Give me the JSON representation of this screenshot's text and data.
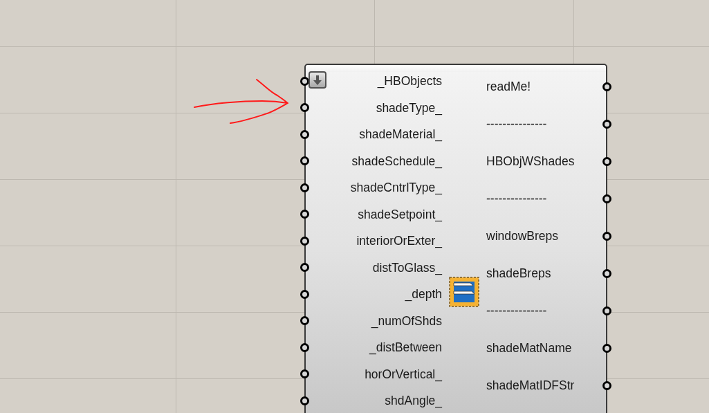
{
  "component": {
    "inputs": [
      {
        "label": "_HBObjects"
      },
      {
        "label": "shadeType_"
      },
      {
        "label": "shadeMaterial_"
      },
      {
        "label": "shadeSchedule_"
      },
      {
        "label": "shadeCntrlType_"
      },
      {
        "label": "shadeSetpoint_"
      },
      {
        "label": "interiorOrExter_"
      },
      {
        "label": "distToGlass_"
      },
      {
        "label": "_depth"
      },
      {
        "label": "_numOfShds"
      },
      {
        "label": "_distBetween"
      },
      {
        "label": "horOrVertical_"
      },
      {
        "label": "shdAngle_"
      }
    ],
    "outputs": [
      {
        "label": "readMe!"
      },
      {
        "label": "---------------"
      },
      {
        "label": "HBObjWShades"
      },
      {
        "label": "---------------"
      },
      {
        "label": "windowBreps"
      },
      {
        "label": "shadeBreps"
      },
      {
        "label": "---------------"
      },
      {
        "label": "shadeMatName"
      },
      {
        "label": "shadeMatIDFStr"
      }
    ]
  }
}
